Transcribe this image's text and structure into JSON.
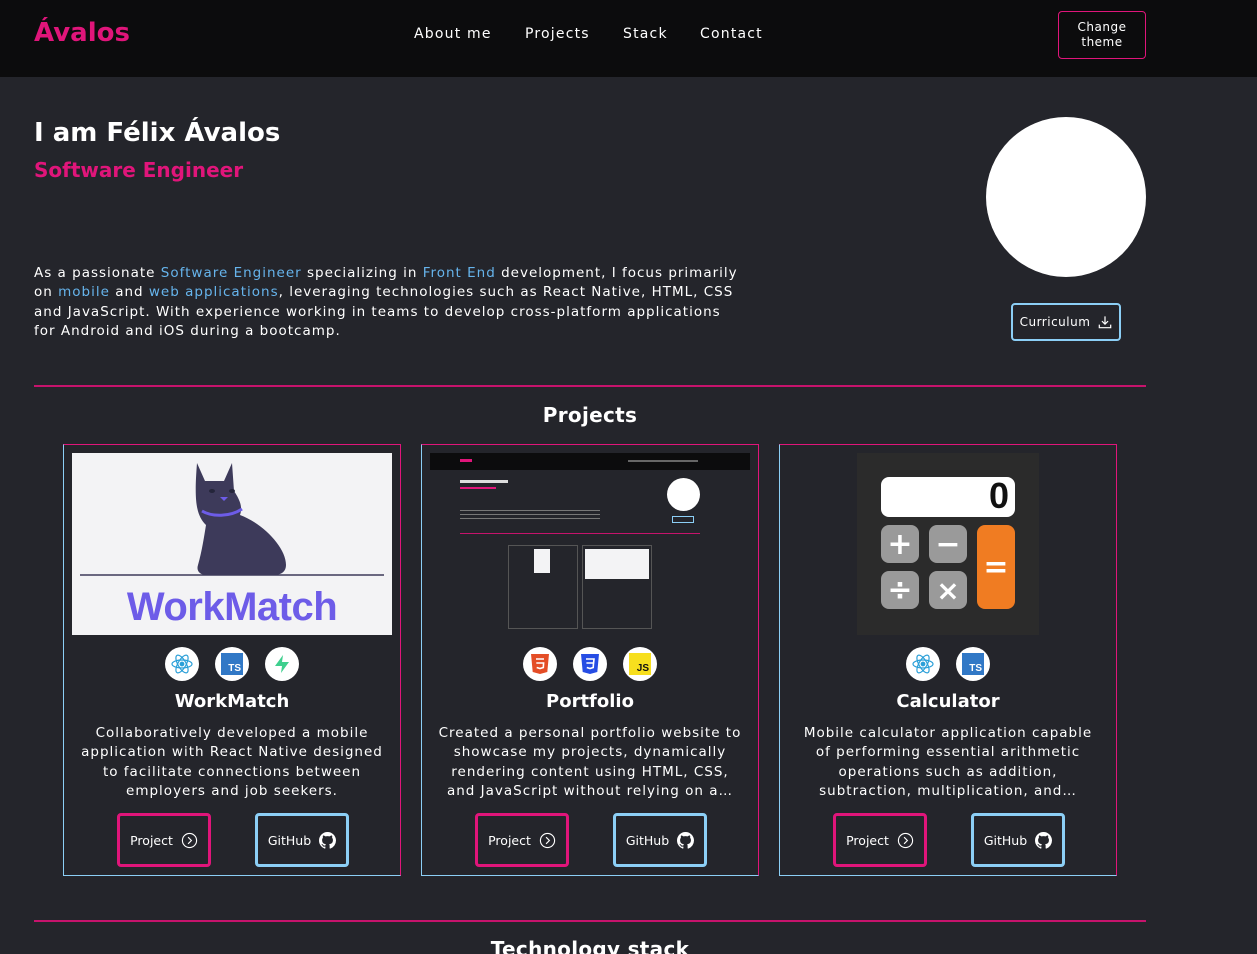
{
  "nav": {
    "logo": "Ávalos",
    "links": [
      "About me",
      "Projects",
      "Stack",
      "Contact"
    ],
    "theme_button": "Change theme"
  },
  "hero": {
    "name": "I am Félix Ávalos",
    "role": "Software Engineer",
    "desc": {
      "p1": "As a passionate ",
      "h1": "Software Engineer",
      "p2": " specializing in ",
      "h2": "Front End",
      "p3": " development, I focus primarily on ",
      "h3": "mobile",
      "p4": " and ",
      "h4": "web applications",
      "p5": ", leveraging technologies such as React Native, HTML, CSS and JavaScript. With experience working in teams to develop cross-platform applications for Android and iOS during a bootcamp."
    },
    "cv_button": "Curriculum"
  },
  "projects": {
    "title": "Projects",
    "cards": [
      {
        "title": "WorkMatch",
        "image_text": "WorkMatch",
        "tech_icons": [
          "react-icon",
          "typescript-icon",
          "supabase-icon"
        ],
        "description": "Collaboratively developed a mobile application with React Native designed to facilitate connections between employers and job seekers.",
        "project_label": "Project",
        "github_label": "GitHub"
      },
      {
        "title": "Portfolio",
        "tech_icons": [
          "html5-icon",
          "css3-icon",
          "javascript-icon"
        ],
        "description": "Created a personal portfolio website to showcase my projects, dynamically rendering content using HTML, CSS, and JavaScript without relying on a…",
        "project_label": "Project",
        "github_label": "GitHub"
      },
      {
        "title": "Calculator",
        "image_display": "0",
        "tech_icons": [
          "react-icon",
          "typescript-icon"
        ],
        "description": "Mobile calculator application capable of performing essential arithmetic operations such as addition, subtraction, multiplication, and…",
        "project_label": "Project",
        "github_label": "GitHub"
      }
    ]
  },
  "stack": {
    "title": "Technology stack"
  },
  "colors": {
    "accent": "#e0157a",
    "secondary": "#8ccff6",
    "background": "#24252b",
    "navbar": "#0c0c0d"
  }
}
